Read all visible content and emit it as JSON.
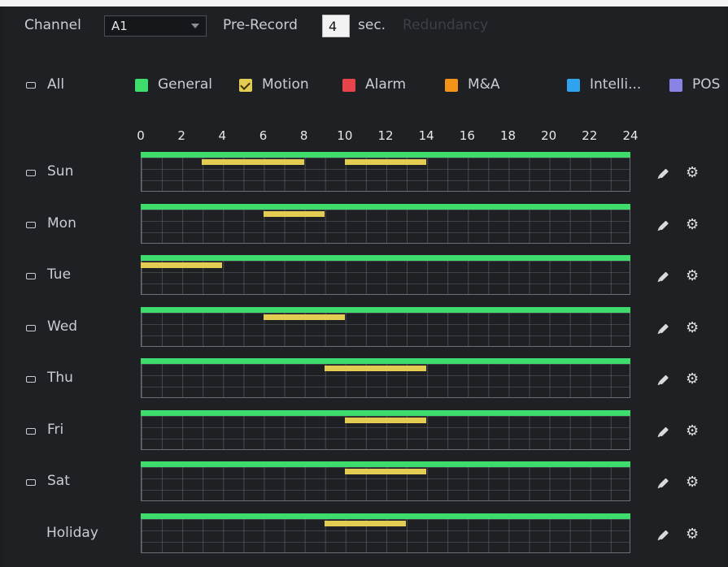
{
  "header": {
    "channel_label": "Channel",
    "channel_value": "A1",
    "prerecord_label": "Pre-Record",
    "prerecord_value": "4",
    "prerecord_unit": "sec.",
    "redundancy_label": "Redundancy"
  },
  "legend": {
    "all_label": "All",
    "items": [
      {
        "label": "General",
        "color": "#3ddc6c",
        "checked": false
      },
      {
        "label": "Motion",
        "color": "#e3cc52",
        "checked": true
      },
      {
        "label": "Alarm",
        "color": "#e8424a",
        "checked": false
      },
      {
        "label": "M&A",
        "color": "#f39318",
        "checked": false
      },
      {
        "label": "Intelli...",
        "color": "#2fa3f0",
        "checked": false
      },
      {
        "label": "POS",
        "color": "#8b82e6",
        "checked": false
      }
    ]
  },
  "timeline": {
    "ticks": [
      "0",
      "2",
      "4",
      "6",
      "8",
      "10",
      "12",
      "14",
      "16",
      "18",
      "20",
      "22",
      "24"
    ]
  },
  "days": [
    {
      "label": "Sun",
      "general": [
        [
          0,
          24
        ]
      ],
      "motion": [
        [
          3,
          8
        ],
        [
          10,
          14
        ]
      ]
    },
    {
      "label": "Mon",
      "general": [
        [
          0,
          24
        ]
      ],
      "motion": [
        [
          6,
          9
        ]
      ]
    },
    {
      "label": "Tue",
      "general": [
        [
          0,
          24
        ]
      ],
      "motion": [
        [
          0,
          4
        ]
      ]
    },
    {
      "label": "Wed",
      "general": [
        [
          0,
          24
        ]
      ],
      "motion": [
        [
          6,
          10
        ]
      ]
    },
    {
      "label": "Thu",
      "general": [
        [
          0,
          24
        ]
      ],
      "motion": [
        [
          9,
          14
        ]
      ]
    },
    {
      "label": "Fri",
      "general": [
        [
          0,
          24
        ]
      ],
      "motion": [
        [
          10,
          14
        ]
      ]
    },
    {
      "label": "Sat",
      "general": [
        [
          0,
          24
        ]
      ],
      "motion": [
        [
          10,
          14
        ]
      ]
    },
    {
      "label": "Holiday",
      "general": [
        [
          0,
          24
        ]
      ],
      "motion": [
        [
          9,
          13
        ]
      ]
    }
  ],
  "icons": {
    "edit": "pencil-icon",
    "settings": "gear-icon"
  }
}
